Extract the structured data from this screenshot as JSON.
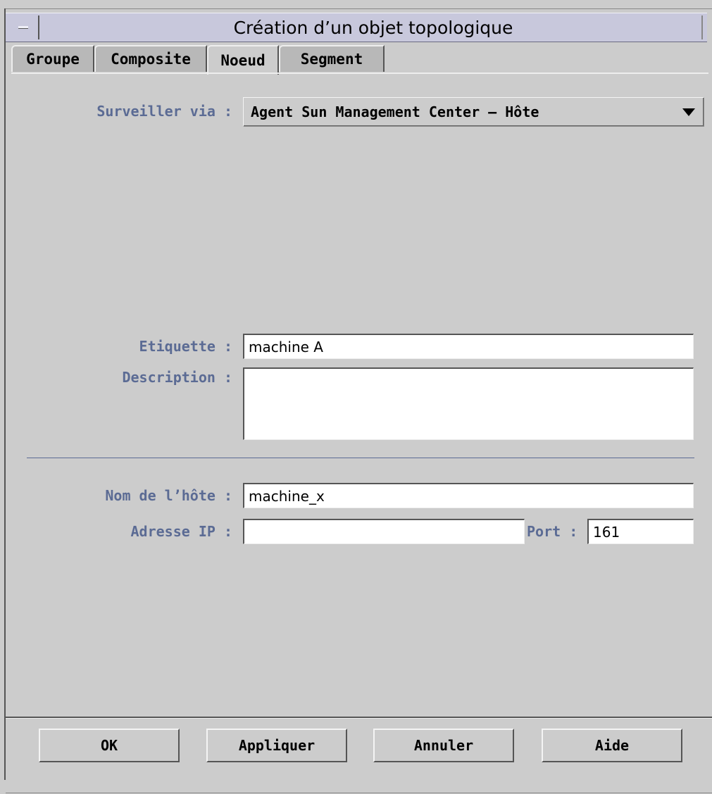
{
  "window": {
    "title": "Création d’un objet topologique"
  },
  "tabs": [
    {
      "label": "Groupe",
      "active": false
    },
    {
      "label": "Composite",
      "active": false
    },
    {
      "label": "Noeud",
      "active": true
    },
    {
      "label": "Segment",
      "active": false
    }
  ],
  "form": {
    "monitor_label": "Surveiller via :",
    "monitor_value": "Agent Sun Management Center – Hôte",
    "label_label": "Etiquette :",
    "label_value": "machine A",
    "description_label": "Description :",
    "description_value": "",
    "hostname_label": "Nom de l’hôte :",
    "hostname_value": "machine_x",
    "ip_label": "Adresse IP :",
    "ip_value": "",
    "port_label": "Port :",
    "port_value": "161"
  },
  "buttons": {
    "ok": "OK",
    "apply": "Appliquer",
    "cancel": "Annuler",
    "help": "Aide"
  },
  "colors": {
    "background": "#cccccc",
    "label_color": "#5b6b94",
    "titlebar": "#c8c8dc"
  }
}
